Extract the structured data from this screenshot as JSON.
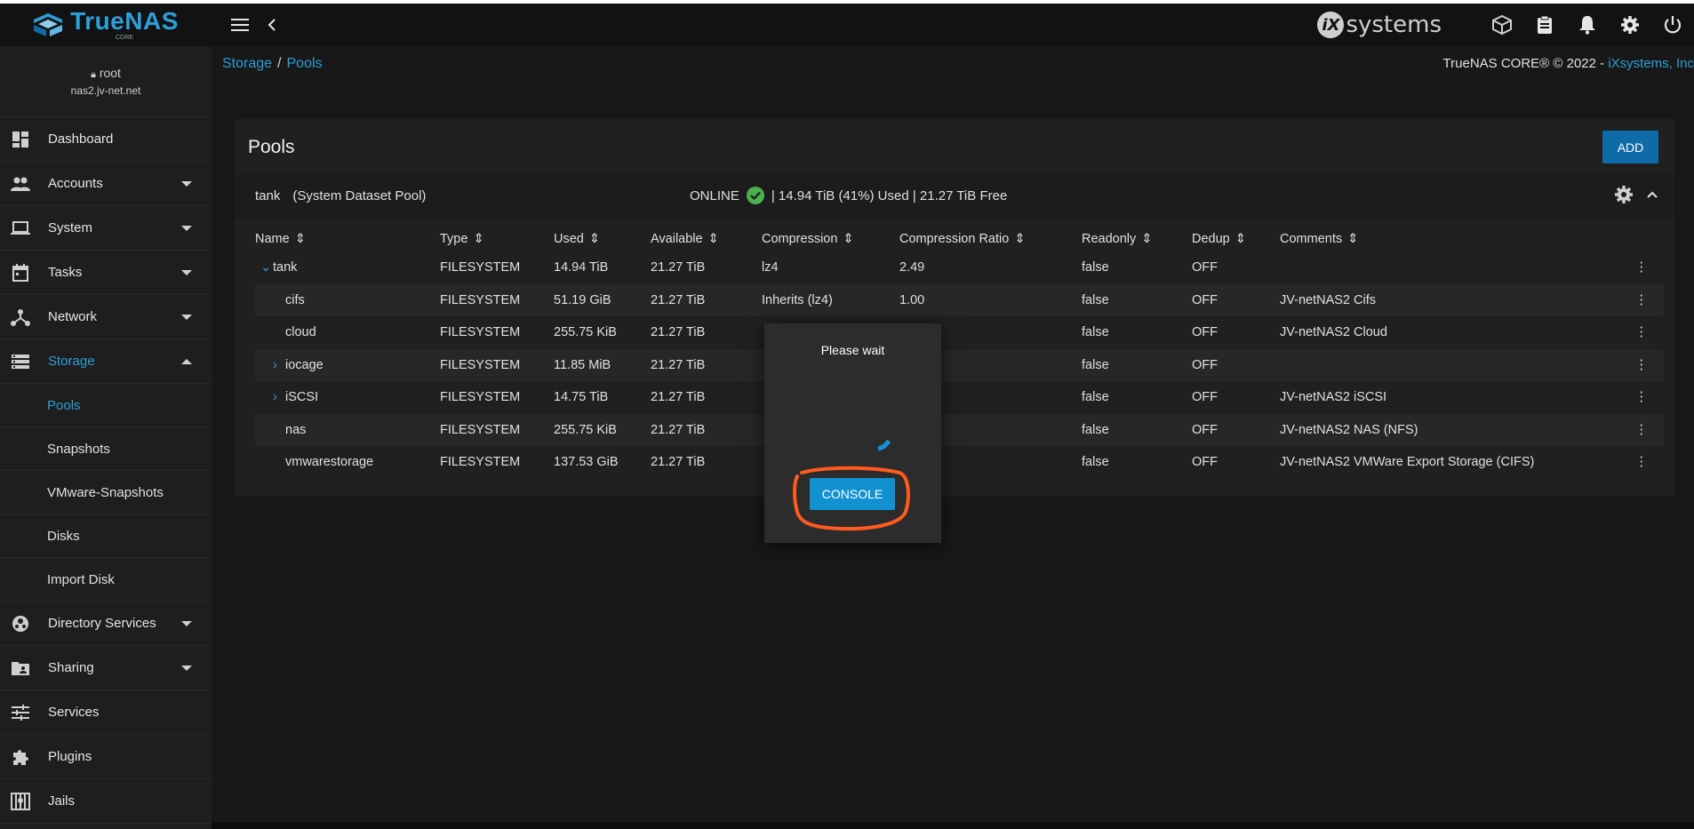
{
  "brand": {
    "name": "TrueNAS",
    "edition": "CORE"
  },
  "topbar": {
    "vendor_prefix": "iX",
    "vendor_name": "systems"
  },
  "user": {
    "name": "root",
    "host": "nas2.jv-net.net"
  },
  "sidebar": {
    "items": [
      {
        "label": "Dashboard"
      },
      {
        "label": "Accounts"
      },
      {
        "label": "System"
      },
      {
        "label": "Tasks"
      },
      {
        "label": "Network"
      },
      {
        "label": "Storage"
      },
      {
        "label": "Directory Services"
      },
      {
        "label": "Sharing"
      },
      {
        "label": "Services"
      },
      {
        "label": "Plugins"
      },
      {
        "label": "Jails"
      }
    ],
    "storage_sub": [
      {
        "label": "Pools"
      },
      {
        "label": "Snapshots"
      },
      {
        "label": "VMware-Snapshots"
      },
      {
        "label": "Disks"
      },
      {
        "label": "Import Disk"
      }
    ]
  },
  "breadcrumb": {
    "root": "Storage",
    "separator": "/",
    "current": "Pools"
  },
  "copyright": {
    "text": "TrueNAS CORE® © 2022 - ",
    "link": "iXsystems, Inc"
  },
  "card": {
    "title": "Pools",
    "add_label": "ADD"
  },
  "pool": {
    "name": "tank",
    "role": "(System Dataset Pool)",
    "status": "ONLINE",
    "usage": "|  14.94 TiB (41%) Used  |  21.27 TiB Free"
  },
  "table": {
    "headers": [
      "Name",
      "Type",
      "Used",
      "Available",
      "Compression",
      "Compression Ratio",
      "Readonly",
      "Dedup",
      "Comments"
    ],
    "rows": [
      {
        "name": "tank",
        "type": "FILESYSTEM",
        "used": "14.94 TiB",
        "available": "21.27 TiB",
        "compression": "lz4",
        "ratio": "2.49",
        "readonly": "false",
        "dedup": "OFF",
        "comments": ""
      },
      {
        "name": "cifs",
        "type": "FILESYSTEM",
        "used": "51.19 GiB",
        "available": "21.27 TiB",
        "compression": "Inherits (lz4)",
        "ratio": "1.00",
        "readonly": "false",
        "dedup": "OFF",
        "comments": "JV-netNAS2 Cifs"
      },
      {
        "name": "cloud",
        "type": "FILESYSTEM",
        "used": "255.75 KiB",
        "available": "21.27 TiB",
        "compression": "",
        "ratio": "",
        "readonly": "false",
        "dedup": "OFF",
        "comments": "JV-netNAS2 Cloud"
      },
      {
        "name": "iocage",
        "type": "FILESYSTEM",
        "used": "11.85 MiB",
        "available": "21.27 TiB",
        "compression": "",
        "ratio": "",
        "readonly": "false",
        "dedup": "OFF",
        "comments": ""
      },
      {
        "name": "iSCSI",
        "type": "FILESYSTEM",
        "used": "14.75 TiB",
        "available": "21.27 TiB",
        "compression": "",
        "ratio": "",
        "readonly": "false",
        "dedup": "OFF",
        "comments": "JV-netNAS2 iSCSI"
      },
      {
        "name": "nas",
        "type": "FILESYSTEM",
        "used": "255.75 KiB",
        "available": "21.27 TiB",
        "compression": "",
        "ratio": "",
        "readonly": "false",
        "dedup": "OFF",
        "comments": "JV-netNAS2 NAS (NFS)"
      },
      {
        "name": "vmwarestorage",
        "type": "FILESYSTEM",
        "used": "137.53 GiB",
        "available": "21.27 TiB",
        "compression": "",
        "ratio": "",
        "readonly": "false",
        "dedup": "OFF",
        "comments": "JV-netNAS2 VMWare Export Storage (CIFS)"
      }
    ]
  },
  "dialog": {
    "title": "Please wait",
    "button": "CONSOLE"
  },
  "colors": {
    "accent": "#2d9fd8",
    "button": "#0f6aa8",
    "console_button": "#1291d1",
    "annotation": "#ff5a1f",
    "online": "#4caf50"
  }
}
